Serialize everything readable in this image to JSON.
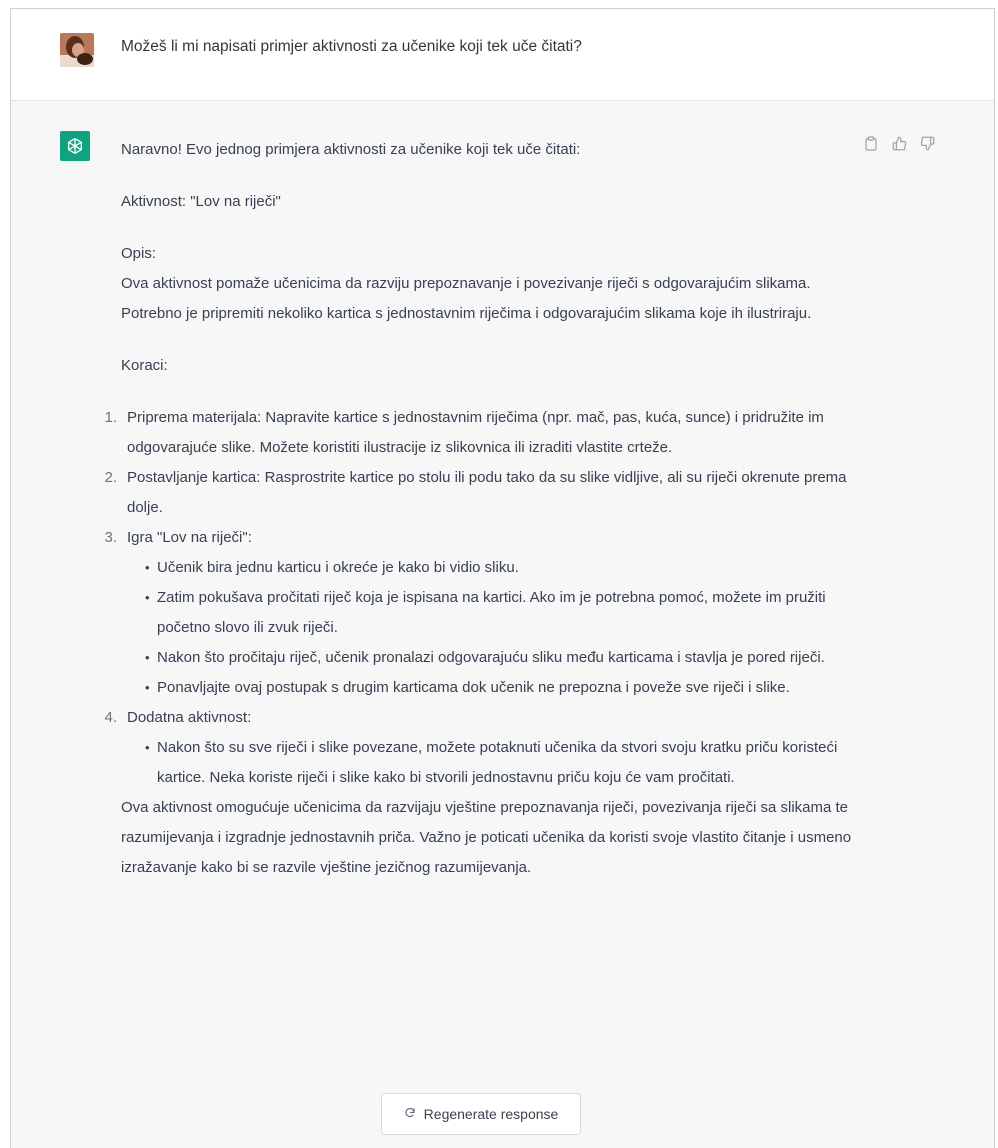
{
  "user_message": {
    "text": "Možeš li mi napisati primjer aktivnosti za učenike koji tek uče čitati?"
  },
  "assistant_message": {
    "intro": "Naravno! Evo jednog primjera aktivnosti za učenike koji tek uče čitati:",
    "activity_title": "Aktivnost: \"Lov na riječi\"",
    "description_heading": "Opis:",
    "description": "Ova aktivnost pomaže učenicima da razviju prepoznavanje i povezivanje riječi s odgovarajućim slikama. Potrebno je pripremiti nekoliko kartica s jednostavnim riječima i odgovarajućim slikama koje ih ilustriraju.",
    "steps_heading": "Koraci:",
    "steps": [
      {
        "num": "1.",
        "text": "Priprema materijala: Napravite kartice s jednostavnim riječima (npr. mač, pas, kuća, sunce) i pridružite im odgovarajuće slike. Možete koristiti ilustracije iz slikovnica ili izraditi vlastite crteže."
      },
      {
        "num": "2.",
        "text": "Postavljanje kartica: Rasprostrite kartice po stolu ili podu tako da su slike vidljive, ali su riječi okrenute prema dolje."
      },
      {
        "num": "3.",
        "text": "Igra \"Lov na riječi\":"
      },
      {
        "num": "4.",
        "text": "Dodatna aktivnost:"
      }
    ],
    "step3_bullets": [
      "Učenik bira jednu karticu i okreće je kako bi vidio sliku.",
      "Zatim pokušava pročitati riječ koja je ispisana na kartici. Ako im je potrebna pomoć, možete im pružiti početno slovo ili zvuk riječi.",
      "Nakon što pročitaju riječ, učenik pronalazi odgovarajuću sliku među karticama i stavlja je pored riječi.",
      "Ponavljajte ovaj postupak s drugim karticama dok učenik ne prepozna i poveže sve riječi i slike."
    ],
    "step4_bullets": [
      "Nakon što su sve riječi i slike povezane, možete potaknuti učenika da stvori svoju kratku priču koristeći kartice. Neka koriste riječi i slike kako bi stvorili jednostavnu priču koju će vam pročitati."
    ],
    "closing": "Ova aktivnost omogućuje učenicima da razvijaju vještine prepoznavanja riječi, povezivanja riječi sa slikama te razumijevanja i izgradnje jednostavnih priča. Važno je poticati učenika da koristi svoje vlastito čitanje i usmeno izražavanje kako bi se razvile vještine jezičnog razumijevanja."
  },
  "actions": {
    "icons": [
      "clipboard-icon",
      "thumbs-up-icon",
      "thumbs-down-icon"
    ]
  },
  "regenerate": {
    "label": "Regenerate response",
    "icon": "refresh-icon"
  },
  "colors": {
    "brand": "#10a37f",
    "assistant_bg": "#f7f7f8",
    "text": "#374151"
  }
}
